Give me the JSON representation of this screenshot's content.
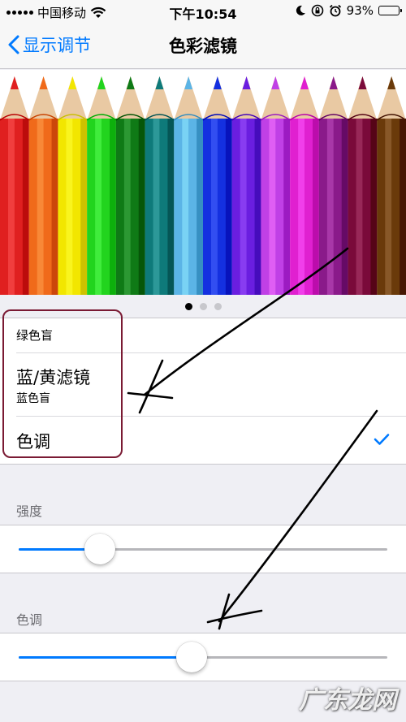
{
  "status_bar": {
    "carrier": "中国移动",
    "time": "下午10:54",
    "battery_percent": "93%",
    "battery_level": 0.93
  },
  "nav": {
    "back_label": "显示调节",
    "title": "色彩滤镜"
  },
  "image": {
    "pencil_colors": [
      "#e02020",
      "#f06a1a",
      "#f2e600",
      "#22d41e",
      "#0f7a16",
      "#0e7a7a",
      "#5bb4e6",
      "#1430e0",
      "#6a1ee0",
      "#c040e6",
      "#e020d0",
      "#8a1a8a",
      "#7a0a3a",
      "#6a3a0a"
    ],
    "page_count": 3,
    "active_page": 0
  },
  "filters": {
    "partial_sub": "绿色盲",
    "blue_yellow": {
      "label": "蓝/黄滤镜",
      "sub": "蓝色盲"
    },
    "tint": {
      "label": "色调",
      "selected": true
    }
  },
  "intensity": {
    "header": "强度",
    "value": 0.22
  },
  "hue": {
    "header": "色调",
    "value": 0.47
  },
  "watermark": "广东龙网",
  "colors": {
    "accent": "#007aff",
    "highlight_box": "#7a1a33"
  }
}
